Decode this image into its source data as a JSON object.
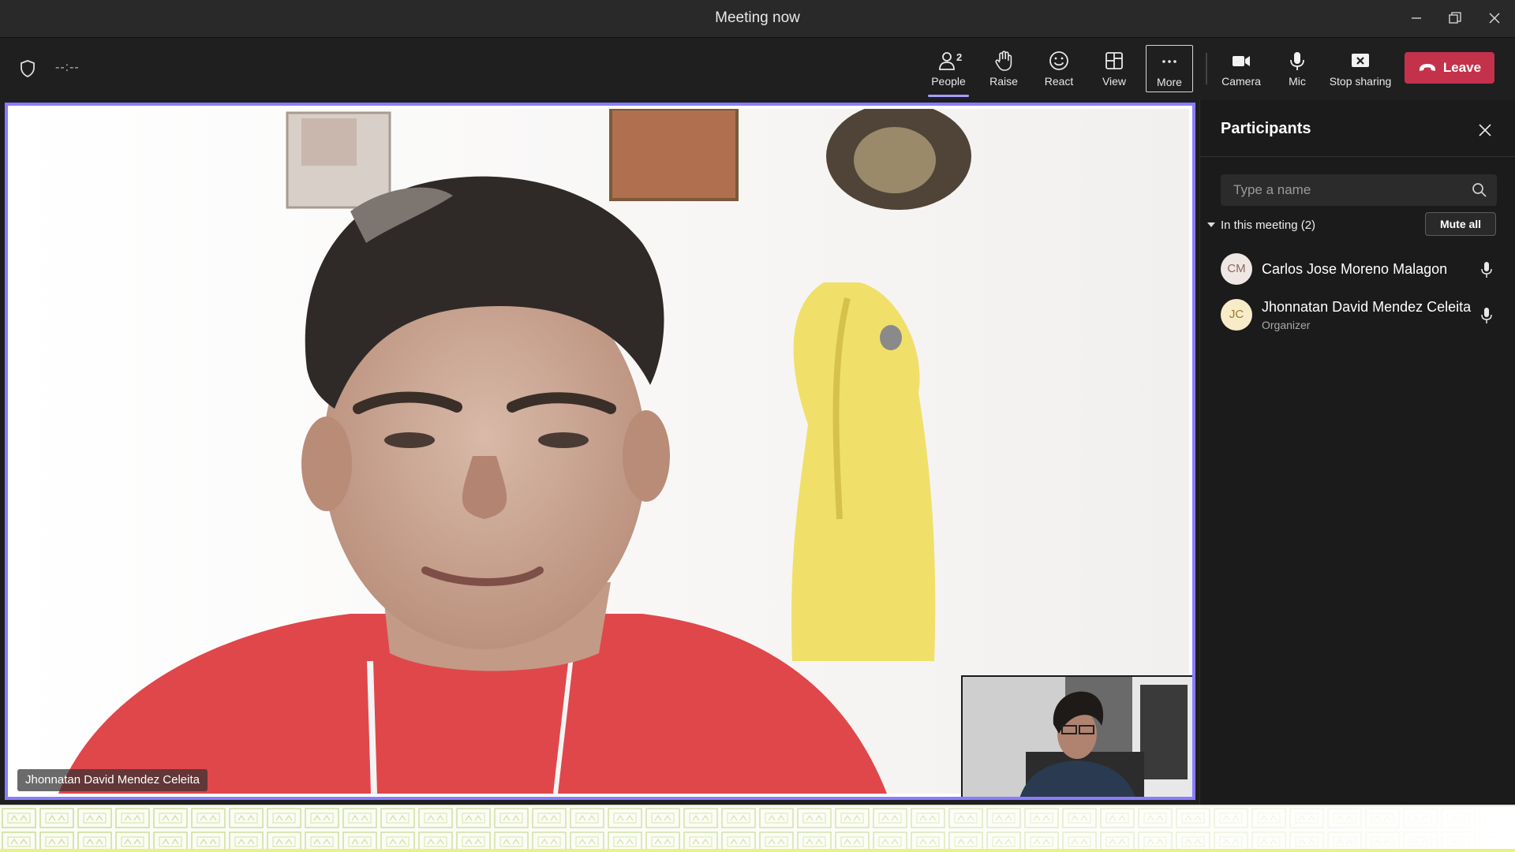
{
  "window": {
    "title": "Meeting now"
  },
  "toolbar": {
    "timer": "--:--",
    "people": {
      "label": "People",
      "count": "2"
    },
    "raise": "Raise",
    "react": "React",
    "view": "View",
    "more": "More",
    "camera": "Camera",
    "mic": "Mic",
    "stop_sharing": "Stop sharing",
    "leave": "Leave"
  },
  "stage": {
    "speaker_name": "Jhonnatan David Mendez Celeita"
  },
  "participants_pane": {
    "title": "Participants",
    "search_placeholder": "Type a name",
    "section_label": "In this meeting (2)",
    "mute_all": "Mute all",
    "people": [
      {
        "initials": "CM",
        "name": "Carlos Jose Moreno Malagon",
        "role": ""
      },
      {
        "initials": "JC",
        "name": "Jhonnatan David Mendez Celeita",
        "role": "Organizer"
      }
    ]
  },
  "colors": {
    "accent": "#8a7dff",
    "leave": "#c4314b",
    "pane_bg": "#1b1b1b"
  }
}
